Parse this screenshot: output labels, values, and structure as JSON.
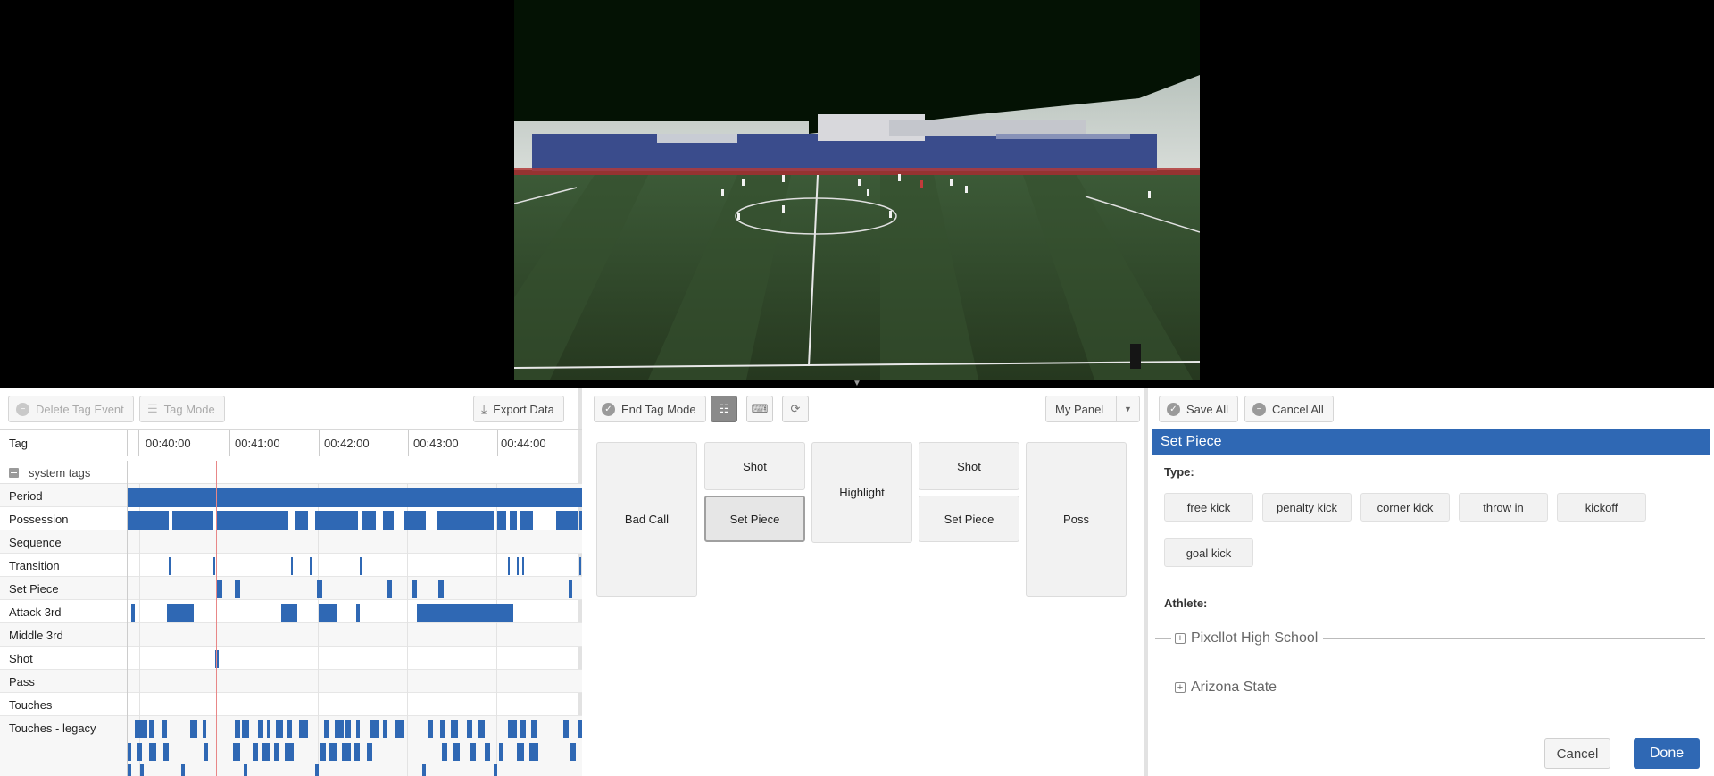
{
  "toolbar_left": {
    "delete_tag_event": "Delete Tag Event",
    "tag_mode": "Tag Mode",
    "export_data": "Export Data"
  },
  "timeline": {
    "tag_column": "Tag",
    "ticks": [
      "00:40:00",
      "00:41:00",
      "00:42:00",
      "00:43:00",
      "00:44:00"
    ],
    "group_label": "system tags",
    "rows": [
      {
        "label": "Period"
      },
      {
        "label": "Possession"
      },
      {
        "label": "Sequence"
      },
      {
        "label": "Transition"
      },
      {
        "label": "Set Piece"
      },
      {
        "label": "Attack 3rd"
      },
      {
        "label": "Middle 3rd"
      },
      {
        "label": "Shot"
      },
      {
        "label": "Pass"
      },
      {
        "label": "Touches"
      },
      {
        "label": "Touches - legacy"
      }
    ]
  },
  "toolbar_mid": {
    "end_tag_mode": "End Tag Mode",
    "panel_select": "My Panel"
  },
  "tag_panel": {
    "buttons": [
      "Bad Call",
      "Shot",
      "Set Piece",
      "Highlight",
      "Shot",
      "Set Piece",
      "Poss"
    ],
    "selected": "Set Piece"
  },
  "toolbar_right": {
    "save_all": "Save All",
    "cancel_all": "Cancel All"
  },
  "editor": {
    "title": "Set Piece",
    "type_label": "Type:",
    "type_options": [
      "free kick",
      "penalty kick",
      "corner kick",
      "throw in",
      "kickoff",
      "goal kick"
    ],
    "athlete_label": "Athlete:",
    "teams": [
      "Pixellot High School",
      "Arizona State"
    ],
    "cancel": "Cancel",
    "done": "Done"
  },
  "colors": {
    "accent": "#2f68b4",
    "playhead": "#e88787"
  }
}
